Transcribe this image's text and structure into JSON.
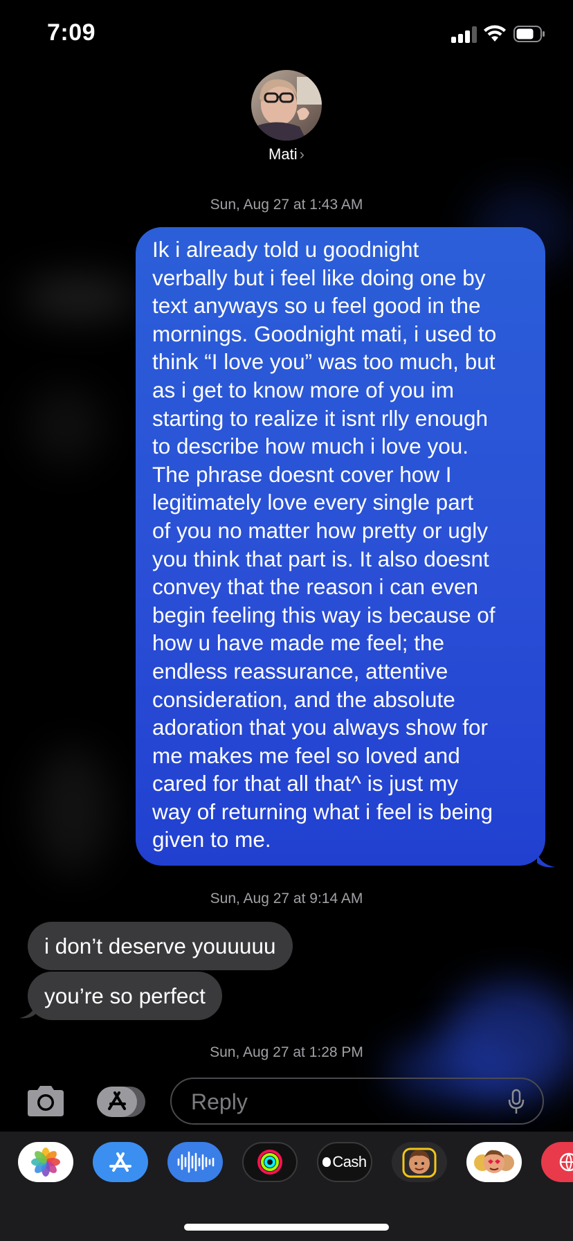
{
  "status_bar": {
    "time": "7:09"
  },
  "contact": {
    "name": "Mati",
    "chevron": "›"
  },
  "thread": {
    "timestamps": [
      "Sun, Aug 27 at 1:43 AM",
      "Sun, Aug 27 at 9:14 AM",
      "Sun, Aug 27 at 1:28 PM"
    ],
    "sent_message": {
      "lines": [
        "Ik i already told u goodnight",
        "verbally but i feel like doing one by",
        "text anyways so u feel good in the",
        "mornings. Goodnight mati, i used to",
        "think “I love you” was too much, but",
        "as i get to know more of you im",
        "starting to realize it isnt rlly enough",
        "to describe how much i love you.",
        "The phrase doesnt cover how I",
        "legitimately love every single part",
        "of you no matter how pretty or ugly",
        "you think that part is. It also doesnt",
        "convey that the reason i can even",
        "begin feeling this way is because of",
        "how u have made me feel; the",
        "endless reassurance, attentive",
        "consideration, and the absolute",
        "adoration that you always show for",
        "me makes me feel so loved and",
        "cared for that all that^ is just my",
        "way of returning what i feel is being",
        "given to me."
      ]
    },
    "received_messages": [
      {
        "text": "i don’t deserve youuuuu"
      },
      {
        "text": "you’re so perfect"
      }
    ]
  },
  "input_bar": {
    "placeholder": "Reply"
  },
  "app_drawer": {
    "apps": [
      {
        "name": "photos-icon"
      },
      {
        "name": "app-store-icon"
      },
      {
        "name": "audio-message-icon"
      },
      {
        "name": "fitness-activity-icon"
      },
      {
        "name": "apple-cash-icon",
        "label": "Cash"
      },
      {
        "name": "memoji-icon"
      },
      {
        "name": "memoji-stickers-icon"
      },
      {
        "name": "digital-touch-icon"
      }
    ]
  },
  "colors": {
    "sent_bubble": "#2a52d6",
    "received_bubble": "#3a3a3c",
    "timestamp_text": "#a1a1a6",
    "background": "#000000"
  }
}
